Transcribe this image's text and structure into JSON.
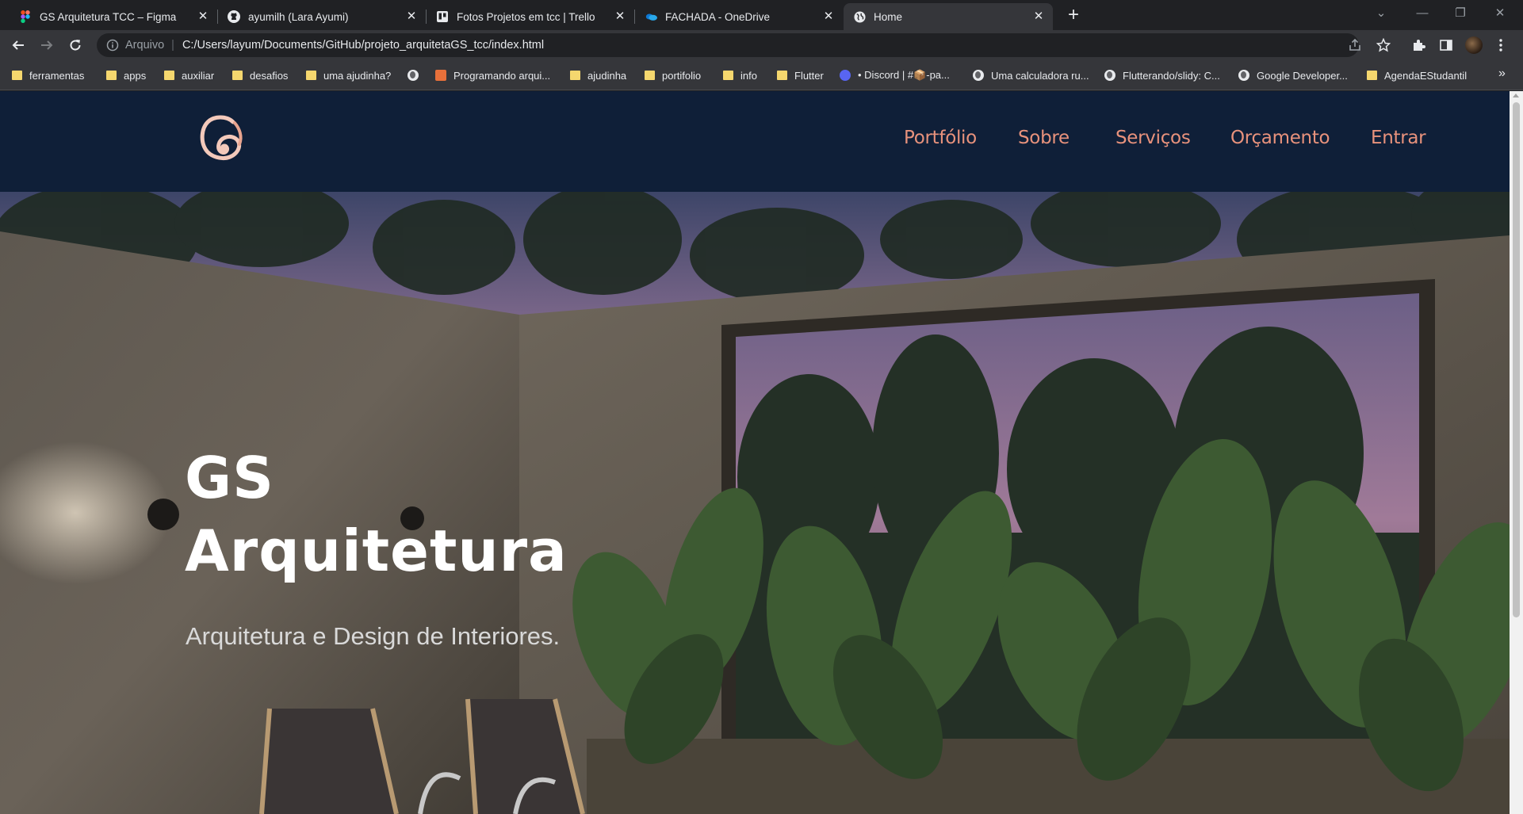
{
  "browser": {
    "tabs": [
      {
        "title": "GS Arquitetura TCC – Figma",
        "icon": "figma-icon"
      },
      {
        "title": "ayumilh (Lara Ayumi)",
        "icon": "github-icon"
      },
      {
        "title": "Fotos Projetos em tcc | Trello",
        "icon": "trello-icon"
      },
      {
        "title": "FACHADA - OneDrive",
        "icon": "onedrive-icon"
      },
      {
        "title": "Home",
        "icon": "globe-icon",
        "active": true
      }
    ],
    "address": {
      "scheme_label": "Arquivo",
      "url": "C:/Users/layum/Documents/GitHub/projeto_arquitetaGS_tcc/index.html"
    },
    "bookmarks": [
      {
        "label": "ferramentas",
        "icon": "folder-icon"
      },
      {
        "label": "apps",
        "icon": "folder-icon"
      },
      {
        "label": "auxiliar",
        "icon": "folder-icon"
      },
      {
        "label": "desafios",
        "icon": "folder-icon"
      },
      {
        "label": "uma ajudinha?",
        "icon": "folder-icon"
      },
      {
        "label": "",
        "icon": "globe-icon"
      },
      {
        "label": "Programando arqui...",
        "icon": "site-icon"
      },
      {
        "label": "ajudinha",
        "icon": "folder-icon"
      },
      {
        "label": "portifolio",
        "icon": "folder-icon"
      },
      {
        "label": "info",
        "icon": "folder-icon"
      },
      {
        "label": "Flutter",
        "icon": "folder-icon"
      },
      {
        "label": "• Discord | #📦-pa...",
        "icon": "discord-icon"
      },
      {
        "label": "Uma calculadora ru...",
        "icon": "globe-icon"
      },
      {
        "label": "Flutterando/slidy: C...",
        "icon": "github-icon"
      },
      {
        "label": "Google Developer...",
        "icon": "globe-icon"
      },
      {
        "label": "AgendaEStudantil",
        "icon": "folder-icon"
      }
    ],
    "more_bookmarks": "»"
  },
  "site": {
    "logo_alt": "GS",
    "nav": [
      "Portfólio",
      "Sobre",
      "Serviços",
      "Orçamento",
      "Entrar"
    ],
    "hero": {
      "title_line1": "GS",
      "title_line2": "Arquitetura",
      "subtitle": "Arquitetura e Design de Interiores."
    }
  },
  "colors": {
    "header_bg": "#0f1f38",
    "nav_text": "#e8927c",
    "hero_title": "#ffffff",
    "hero_subtitle": "#d9d9d9"
  }
}
